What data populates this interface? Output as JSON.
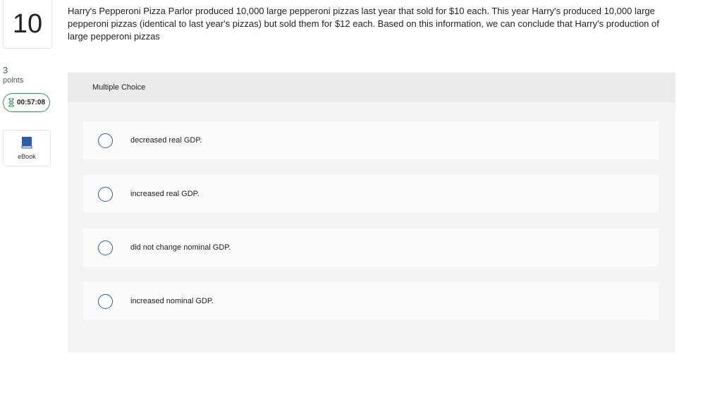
{
  "question_number": "10",
  "points": {
    "value": "3",
    "label": "points"
  },
  "timer": {
    "text": "00:57:08",
    "icon": "hourglass-icon"
  },
  "ebook": {
    "label": "eBook",
    "icon": "book-icon"
  },
  "question": {
    "text": "Harry's Pepperoni Pizza Parlor produced 10,000 large pepperoni pizzas last year that sold for $10 each. This year Harry's produced 10,000 large pepperoni pizzas (identical to last year's pizzas) but sold them for $12 each. Based on this information, we can conclude that Harry's production of large pepperoni pizzas"
  },
  "multiple_choice": {
    "header": "Multiple Choice",
    "options": [
      {
        "label": "decreased real GDP.",
        "selected": false
      },
      {
        "label": "increased real GDP.",
        "selected": false
      },
      {
        "label": "did not change nominal GDP.",
        "selected": false
      },
      {
        "label": "increased nominal GDP.",
        "selected": false
      }
    ]
  },
  "colors": {
    "accent": "#1f5fa8",
    "timer_border": "#3e8e57",
    "panel_bg": "#f4f4f4",
    "header_bg": "#ebebeb"
  }
}
